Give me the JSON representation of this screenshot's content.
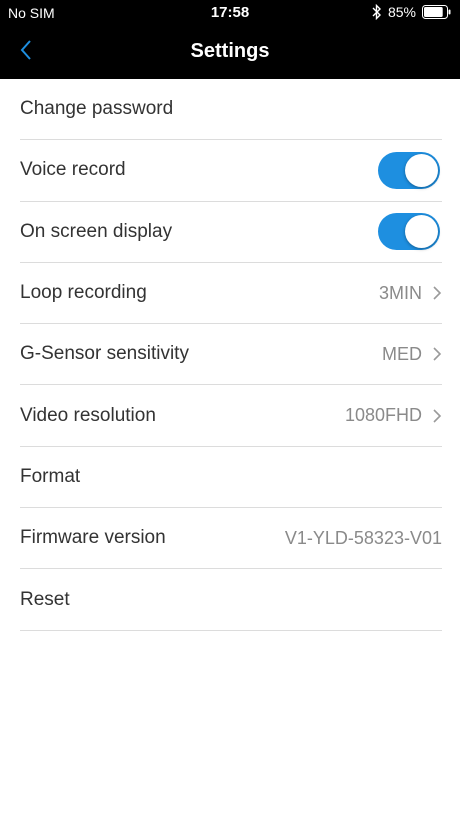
{
  "status_bar": {
    "carrier": "No SIM",
    "time": "17:58",
    "battery": "85%",
    "battery_level": 0.85,
    "bluetooth_icon": "bluetooth-icon",
    "battery_icon": "battery-icon"
  },
  "nav": {
    "title": "Settings",
    "back_icon": "chevron-left-icon"
  },
  "colors": {
    "accent": "#1e8fe0",
    "header_bg": "#000000",
    "label": "#333333",
    "value": "#8a8a8a",
    "divider": "#dcdcdc"
  },
  "settings": [
    {
      "label": "Change password"
    },
    {
      "label": "Voice record",
      "toggle": true
    },
    {
      "label": "On screen display",
      "toggle": true
    },
    {
      "label": "Loop recording",
      "value": "3MIN"
    },
    {
      "label": "G-Sensor sensitivity",
      "value": "MED"
    },
    {
      "label": "Video resolution",
      "value": "1080FHD"
    },
    {
      "label": "Format"
    },
    {
      "label": "Firmware version",
      "value": "V1-YLD-58323-V01"
    },
    {
      "label": "Reset"
    }
  ]
}
